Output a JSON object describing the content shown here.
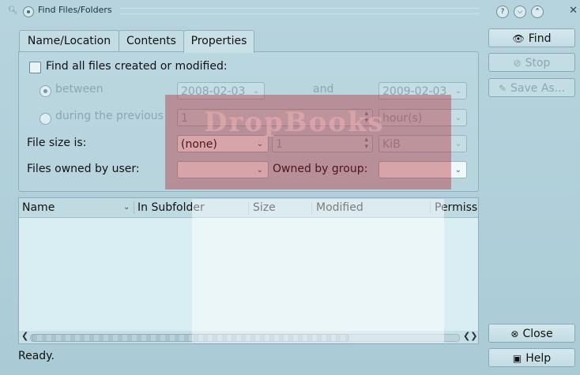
{
  "window": {
    "title": "Find Files/Folders"
  },
  "tabs": [
    "Name/Location",
    "Contents",
    "Properties"
  ],
  "properties": {
    "find_all_label": "Find all files created or modified:",
    "between_label": "between",
    "from_date": "2008-02-03",
    "and_label": "and",
    "to_date": "2009-02-03",
    "during_label": "during the previous",
    "during_value": "1",
    "during_unit": "hour(s)",
    "size_label": "File size is:",
    "size_mode": "(none)",
    "size_value": "1",
    "size_unit": "KiB",
    "owner_label": "Files owned by user:",
    "owner_value": "",
    "group_label": "Owned by group:",
    "group_value": ""
  },
  "results": {
    "columns": [
      "Name",
      "In Subfolder",
      "Size",
      "Modified",
      "Permiss"
    ]
  },
  "buttons": {
    "find": "Find",
    "stop": "Stop",
    "save_as": "Save As...",
    "close": "Close",
    "help": "Help"
  },
  "status": "Ready.",
  "watermark": "DropBooks"
}
